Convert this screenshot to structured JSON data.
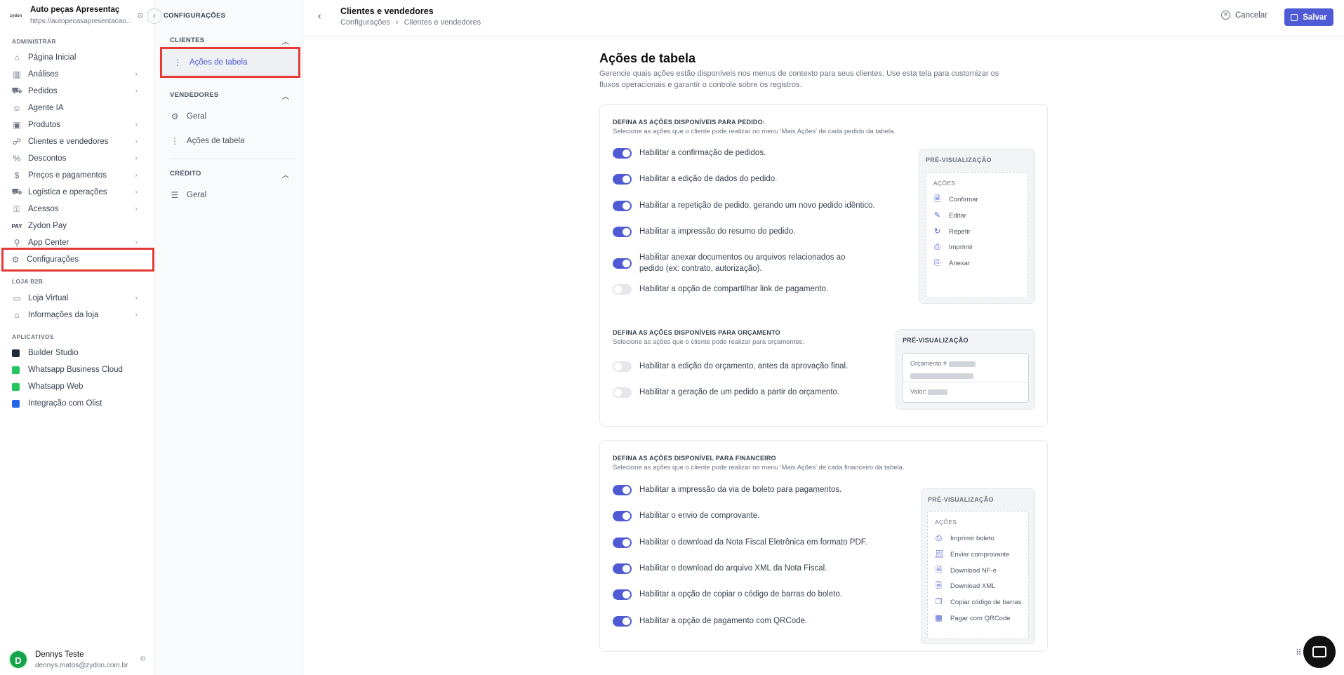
{
  "org": {
    "name": "Auto peças Apresentaç",
    "url": "https://autopecasapresentacao...",
    "logo_text": "zydon"
  },
  "sidebar": {
    "sections": {
      "admin": "ADMINISTRAR",
      "store": "LOJA B2B",
      "apps": "APLICATIVOS"
    },
    "admin_items": [
      {
        "label": "Página Inicial",
        "icon": "home-icon"
      },
      {
        "label": "Análises",
        "icon": "chart-icon"
      },
      {
        "label": "Pedidos",
        "icon": "cart-icon"
      },
      {
        "label": "Agente IA",
        "icon": "bot-icon"
      },
      {
        "label": "Produtos",
        "icon": "box-icon"
      },
      {
        "label": "Clientes e vendedores",
        "icon": "users-icon"
      },
      {
        "label": "Descontos",
        "icon": "discount-icon"
      },
      {
        "label": "Preços e pagamentos",
        "icon": "dollar-icon"
      },
      {
        "label": "Logística e operações",
        "icon": "truck-icon"
      },
      {
        "label": "Acessos",
        "icon": "key-icon"
      },
      {
        "label": "Zydon Pay",
        "icon": "pay-icon"
      },
      {
        "label": "App Center",
        "icon": "plug-icon"
      },
      {
        "label": "Configurações",
        "icon": "gear-icon"
      }
    ],
    "store_items": [
      {
        "label": "Loja Virtual",
        "icon": "window-icon"
      },
      {
        "label": "Informações da loja",
        "icon": "store-icon"
      }
    ],
    "apps": [
      {
        "label": "Builder Studio",
        "color": "#1f2937"
      },
      {
        "label": "Whatsapp Business Cloud",
        "color": "#22c55e"
      },
      {
        "label": "Whatsapp Web",
        "color": "#22c55e"
      },
      {
        "label": "Integração com Olist",
        "color": "#2563eb"
      }
    ]
  },
  "user": {
    "initial": "D",
    "name": "Dennys Teste",
    "email": "dennys.matos@zydon.com.br"
  },
  "subnav": {
    "title": "CONFIGURAÇÕES",
    "clientes": {
      "label": "CLIENTES",
      "items": [
        "Ações de tabela"
      ]
    },
    "vendedores": {
      "label": "VENDEDORES",
      "items": [
        "Geral",
        "Ações de tabela"
      ]
    },
    "credito": {
      "label": "CRÉDITO",
      "items": [
        "Geral"
      ]
    }
  },
  "header": {
    "title": "Clientes e vendedores",
    "crumbs": [
      "Configurações",
      "Clientes e vendedores"
    ],
    "cancel": "Cancelar",
    "save": "Salvar"
  },
  "page": {
    "title": "Ações de tabela",
    "desc": "Gerencie quais ações estão disponíveis nos menus de contexto para seus clientes. Use esta tela para customizar os fluxos operacionais e garantir o controle sobre os registros."
  },
  "pedido": {
    "heading": "DEFINA AS AÇÕES DISPONÍVEIS PARA PEDIDO:",
    "sub": "Selecione as ações que o cliente pode realizar no menu 'Mais Ações' de cada pedido da tabela.",
    "options": [
      {
        "label": "Habilitar a confirmação de pedidos.",
        "on": true
      },
      {
        "label": "Habilitar a edição de dados do pedido.",
        "on": true
      },
      {
        "label": "Habilitar a repetição de pedido, gerando um novo pedido idêntico.",
        "on": true
      },
      {
        "label": "Habilitar a impressão do resumo do pedido.",
        "on": true
      },
      {
        "label": "Habilitar anexar documentos ou arquivos relacionados ao pedido (ex: contrato, autorização).",
        "on": true
      },
      {
        "label": "Habilitar a opção de compartilhar link de pagamento.",
        "on": false
      }
    ],
    "preview": {
      "label": "PRÉ-VISUALIZAÇÃO",
      "head": "AÇÕES",
      "items": [
        {
          "label": "Confirmar",
          "icon": "file-check-icon"
        },
        {
          "label": "Editar",
          "icon": "pencil-icon"
        },
        {
          "label": "Repetir",
          "icon": "refresh-icon"
        },
        {
          "label": "Imprimir",
          "icon": "printer-icon"
        },
        {
          "label": "Anexar",
          "icon": "paperclip-icon"
        }
      ]
    }
  },
  "orcamento": {
    "heading": "DEFINA AS AÇÕES DISPONÍVEIS PARA ORÇAMENTO",
    "sub": "Selecione as ações que o cliente pode realizar para orçamentos.",
    "options": [
      {
        "label": "Habilitar a edição do orçamento, antes da aprovação final.",
        "on": false
      },
      {
        "label": "Habilitar a geração de um pedido a partir do orçamento.",
        "on": false
      }
    ],
    "preview": {
      "label": "PRÉ-VISUALIZAÇÃO",
      "quote_label": "Orçamento #",
      "value_label": "Valor:"
    }
  },
  "financeiro": {
    "heading": "DEFINA AS AÇÕES DISPONÍVEL PARA FINANCEIRO",
    "sub": "Selecione as ações que o cliente pode realizar no menu 'Mais Ações' de cada financeiro da tabela.",
    "options": [
      {
        "label": "Habilitar a impressão da via de boleto para pagamentos.",
        "on": true
      },
      {
        "label": "Habilitar o envio de comprovante.",
        "on": true
      },
      {
        "label": "Habilitar o download da Nota Fiscal Eletrônica em formato PDF.",
        "on": true
      },
      {
        "label": "Habilitar o download do arquivo XML da Nota Fiscal.",
        "on": true
      },
      {
        "label": "Habilitar a opção de copiar o código de barras do boleto.",
        "on": true
      },
      {
        "label": "Habilitar a opção de pagamento com QRCode.",
        "on": true
      }
    ],
    "preview": {
      "label": "PRÉ-VISUALIZAÇÃO",
      "head": "AÇÕES",
      "items": [
        {
          "label": "Imprimir boleto",
          "icon": "printer-icon"
        },
        {
          "label": "Enviar comprovante",
          "icon": "receipt-icon"
        },
        {
          "label": "Download NF-e",
          "icon": "file-pdf-icon"
        },
        {
          "label": "Download XML",
          "icon": "file-xml-icon"
        },
        {
          "label": "Copiar código de barras",
          "icon": "copy-icon"
        },
        {
          "label": "Pagar com QRCode",
          "icon": "qrcode-icon"
        }
      ]
    }
  },
  "colors": {
    "accent": "#4f5bd5",
    "highlight": "#e53935"
  }
}
